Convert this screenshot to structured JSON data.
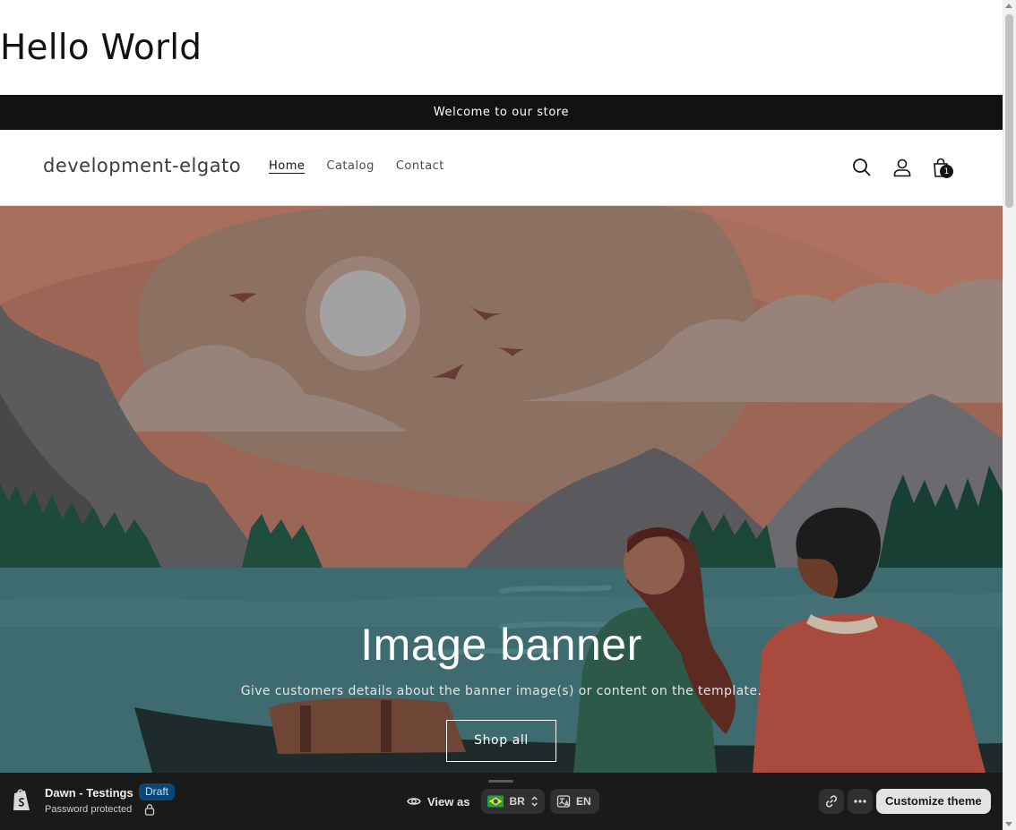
{
  "page": {
    "heading": "Hello World"
  },
  "announcement": {
    "text": "Welcome to our store"
  },
  "header": {
    "store_name": "development-elgato",
    "nav": [
      {
        "label": "Home",
        "active": true
      },
      {
        "label": "Catalog",
        "active": false
      },
      {
        "label": "Contact",
        "active": false
      }
    ],
    "icons": [
      "search-icon",
      "account-icon",
      "cart-icon"
    ],
    "cart_count": "1"
  },
  "banner": {
    "title": "Image banner",
    "text": "Give customers details about the banner image(s) or content on the template.",
    "button_label": "Shop all"
  },
  "preview_bar": {
    "theme_name": "Dawn - Testings",
    "badge": "Draft",
    "status": "Password protected",
    "view_as_label": "View as",
    "country": "BR",
    "language": "EN",
    "customize_label": "Customize theme",
    "icons": [
      "shopify-logo-icon",
      "lock-icon",
      "eye-icon",
      "brazil-flag-icon",
      "chevron-updown-icon",
      "translate-icon",
      "link-icon",
      "more-icon"
    ]
  },
  "colors": {
    "announcement_bg": "#121212",
    "sky": "#a9705e",
    "water": "#3e6b6f",
    "preview_bar_bg": "#1a1a1a",
    "draft_badge_bg": "#0b4776"
  }
}
